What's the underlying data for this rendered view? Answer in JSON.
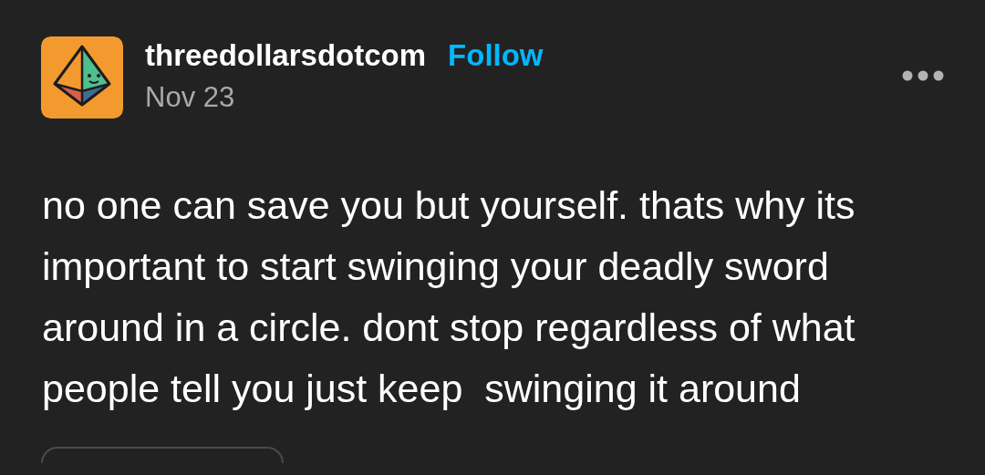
{
  "post": {
    "author": "threedollarsdotcom",
    "follow": "Follow",
    "date": "Nov 23",
    "body": "no one can save you but yourself. thats why its important to start swinging your deadly sword around in a circle. dont stop regardless of what people tell you just keep  swinging it around"
  }
}
